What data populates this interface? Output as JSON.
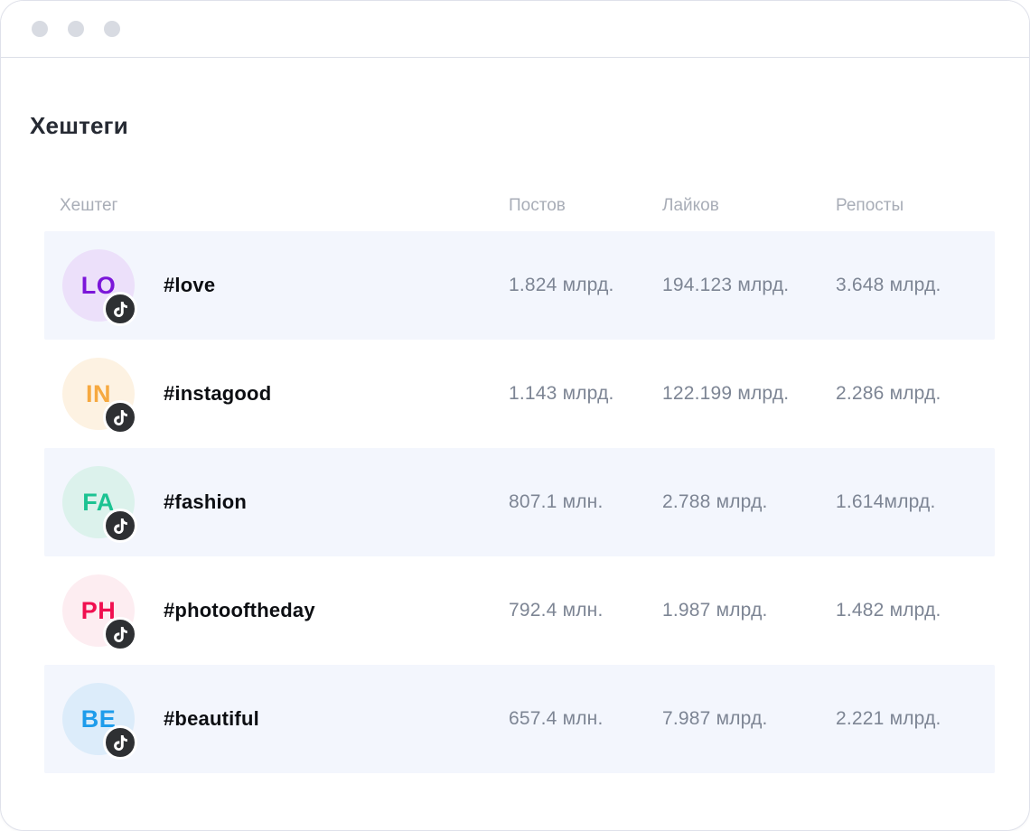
{
  "window": {
    "controls": [
      "dot",
      "dot",
      "dot"
    ]
  },
  "page_title": "Хештеги",
  "table": {
    "headers": [
      "Хештег",
      "Постов",
      "Лайков",
      "Репосты"
    ],
    "rows": [
      {
        "initials": "LO",
        "hashtag": "#love",
        "posts": "1.824 млрд.",
        "likes": "194.123 млрд.",
        "reposts": "3.648 млрд.",
        "avatar_bg": "#ece0fa",
        "avatar_color": "#7b16d9",
        "platform_icon": "tiktok-icon",
        "highlighted": true
      },
      {
        "initials": "IN",
        "hashtag": "#instagood",
        "posts": "1.143 млрд.",
        "likes": "122.199 млрд.",
        "reposts": "2.286 млрд.",
        "avatar_bg": "#fdf2e2",
        "avatar_color": "#f6a940",
        "platform_icon": "tiktok-icon",
        "highlighted": false
      },
      {
        "initials": "FA",
        "hashtag": "#fashion",
        "posts": "807.1 млн.",
        "likes": "2.788 млрд.",
        "reposts": "1.614млрд.",
        "avatar_bg": "#dcf2ec",
        "avatar_color": "#1cc392",
        "platform_icon": "tiktok-icon",
        "highlighted": true
      },
      {
        "initials": "PH",
        "hashtag": "#photooftheday",
        "posts": "792.4 млн.",
        "likes": "1.987 млрд.",
        "reposts": "1.482 млрд.",
        "avatar_bg": "#fdedf1",
        "avatar_color": "#f01050",
        "platform_icon": "tiktok-icon",
        "highlighted": false
      },
      {
        "initials": "BE",
        "hashtag": "#beautiful",
        "posts": "657.4 млн.",
        "likes": "7.987 млрд.",
        "reposts": "2.221 млрд.",
        "avatar_bg": "#dcecfa",
        "avatar_color": "#1e9ceb",
        "platform_icon": "tiktok-icon",
        "highlighted": true
      }
    ]
  },
  "colors": {
    "row_highlight": "#f3f6fd",
    "header_text": "#a8adb7",
    "value_text": "#7d8594",
    "hashtag_text": "#0c0e12",
    "title_text": "#262a33",
    "titlebar_dot": "#d8dbe2",
    "card_border": "#dfe1ea",
    "badge_bg": "#2e3033"
  }
}
